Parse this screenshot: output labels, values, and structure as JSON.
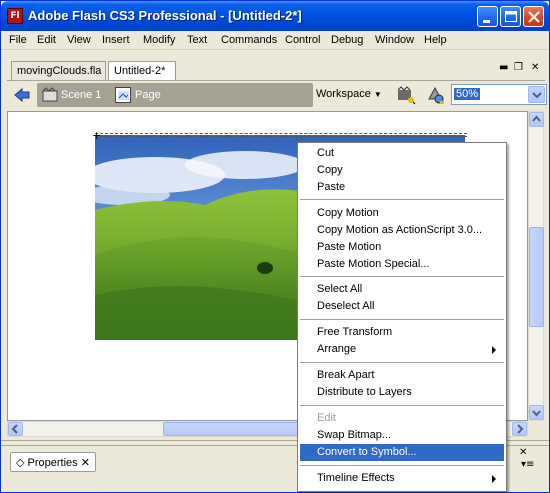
{
  "window": {
    "title": "Adobe Flash CS3 Professional - [Untitled-2*]",
    "app_icon_text": "Fl"
  },
  "menubar": [
    "File",
    "Edit",
    "View",
    "Insert",
    "Modify",
    "Text",
    "Commands",
    "Control",
    "Debug",
    "Window",
    "Help"
  ],
  "tabs": [
    {
      "label": "movingClouds.fla",
      "active": false
    },
    {
      "label": "Untitled-2*",
      "active": true
    }
  ],
  "editbar": {
    "scene_label": "Scene 1",
    "page_label": "Page",
    "workspace_label": "Workspace",
    "zoom_value": "50%"
  },
  "properties_panel": {
    "tab_label": "Properties"
  },
  "context_menu": {
    "groups": [
      [
        {
          "label": "Cut"
        },
        {
          "label": "Copy"
        },
        {
          "label": "Paste"
        }
      ],
      [
        {
          "label": "Copy Motion"
        },
        {
          "label": "Copy Motion as ActionScript 3.0..."
        },
        {
          "label": "Paste Motion"
        },
        {
          "label": "Paste Motion Special..."
        }
      ],
      [
        {
          "label": "Select All"
        },
        {
          "label": "Deselect All"
        }
      ],
      [
        {
          "label": "Free Transform"
        },
        {
          "label": "Arrange",
          "submenu": true
        }
      ],
      [
        {
          "label": "Break Apart"
        },
        {
          "label": "Distribute to Layers"
        }
      ],
      [
        {
          "label": "Edit",
          "disabled": true
        },
        {
          "label": "Swap Bitmap..."
        },
        {
          "label": "Convert to Symbol...",
          "highlighted": true
        }
      ],
      [
        {
          "label": "Timeline Effects",
          "submenu": true
        }
      ]
    ]
  },
  "colors": {
    "titlebar": "#0055e5",
    "highlight": "#316ac5",
    "scene_bar": "#a5a294"
  },
  "icons": [
    "app-icon",
    "minimize-icon",
    "maximize-icon",
    "close-icon",
    "back-arrow-icon",
    "scene-icon",
    "page-icon",
    "edit-symbols-icon",
    "edit-objects-icon",
    "dropdown-arrow-icon",
    "submenu-arrow-icon"
  ]
}
